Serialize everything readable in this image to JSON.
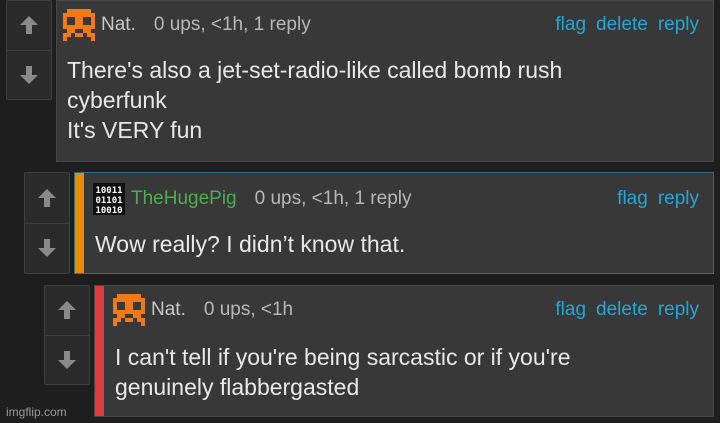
{
  "comments": [
    {
      "username": "Nat.",
      "meta": "0 ups, <1h, 1 reply",
      "actions": [
        "flag",
        "delete",
        "reply"
      ],
      "text": "There's also a jet-set-radio-like called bomb rush\ncyberfunk\nIt's VERY fun"
    },
    {
      "username": "TheHugePig",
      "meta": "0 ups, <1h, 1 reply",
      "actions": [
        "flag",
        "reply"
      ],
      "text": "Wow really? I didn’t know that.",
      "accent_color": "#f08a00",
      "username_color": "#4cae4c"
    },
    {
      "username": "Nat.",
      "meta": "0 ups, <1h",
      "actions": [
        "flag",
        "delete",
        "reply"
      ],
      "text": "I can't tell if you're being sarcastic or if you're\ngenuinely flabbergasted",
      "accent_color": "#e0393e"
    }
  ],
  "watermark": "imgflip.com",
  "icons": {
    "upvote": "arrow-up-icon",
    "downvote": "arrow-down-icon",
    "avatar_nat": "orange-pixel-skull-icon",
    "avatar_pig": "binary-digits-icon"
  },
  "colors": {
    "link": "#20a8d8",
    "panel": "#383838",
    "background": "#1e1e1e"
  }
}
